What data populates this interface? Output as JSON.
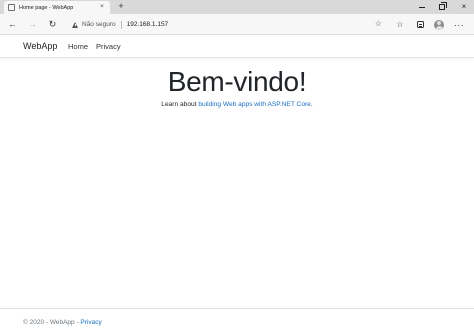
{
  "browser": {
    "tab_title": "Home page - WebApp",
    "tab_close": "×",
    "new_tab": "+",
    "security_label": "Não seguro",
    "url": "192.168.1.157",
    "window_close": "×"
  },
  "icons": {
    "back": "arrow-left-icon",
    "forward": "arrow-right-icon",
    "reload": "reload-icon",
    "favorite": "star-icon",
    "favorites_bar": "favorites-icon",
    "collections": "collections-icon",
    "profile": "profile-icon",
    "menu": "more-icon"
  },
  "site": {
    "brand": "WebApp",
    "nav": {
      "home": "Home",
      "privacy": "Privacy"
    }
  },
  "main": {
    "title": "Bem-vindo!",
    "learn_prefix": "Learn about ",
    "learn_link": "building Web apps with ASP.NET Core",
    "learn_suffix": "."
  },
  "footer": {
    "copyright": "© 2020 - WebApp - ",
    "privacy_link": "Privacy"
  },
  "colors": {
    "link": "#1b6ec2",
    "tabstrip": "#d9d9d9",
    "toolbar": "#f7f7f7"
  }
}
